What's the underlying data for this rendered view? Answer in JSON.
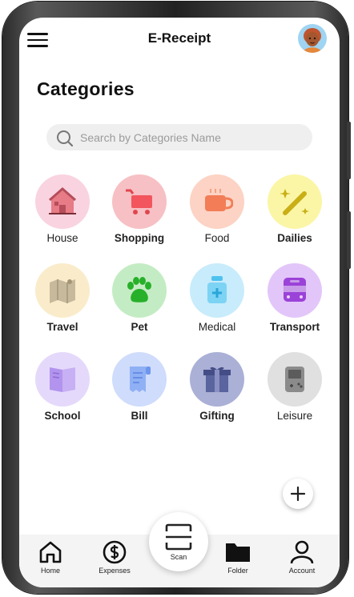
{
  "header": {
    "title": "E-Receipt",
    "menu_icon": "hamburger-menu-icon",
    "avatar_icon": "user-avatar"
  },
  "page_title": "Categories",
  "search": {
    "placeholder": "Search by Categories Name",
    "value": "",
    "icon": "search-icon"
  },
  "categories": [
    {
      "label": "House",
      "icon": "house-icon",
      "circle_color": "#f9d3e0",
      "bold": false
    },
    {
      "label": "Shopping",
      "icon": "shopping-cart-icon",
      "circle_color": "#f7c0c4",
      "bold": true
    },
    {
      "label": "Food",
      "icon": "hot-drink-icon",
      "circle_color": "#fcd3c4",
      "bold": false
    },
    {
      "label": "Dailies",
      "icon": "magic-wand-icon",
      "circle_color": "#fbf6a6",
      "bold": true
    },
    {
      "label": "Travel",
      "icon": "map-icon",
      "circle_color": "#faeccb",
      "bold": true
    },
    {
      "label": "Pet",
      "icon": "paw-icon",
      "circle_color": "#c4ecc4",
      "bold": true
    },
    {
      "label": "Medical",
      "icon": "medicine-bottle-icon",
      "circle_color": "#c8ecfb",
      "bold": false
    },
    {
      "label": "Transport",
      "icon": "train-icon",
      "circle_color": "#e3c6f9",
      "bold": true
    },
    {
      "label": "School",
      "icon": "open-book-icon",
      "circle_color": "#e5d9fb",
      "bold": true
    },
    {
      "label": "Bill",
      "icon": "bill-icon",
      "circle_color": "#cfdcfb",
      "bold": true
    },
    {
      "label": "Gifting",
      "icon": "gift-box-icon",
      "circle_color": "#aab0d6",
      "bold": true
    },
    {
      "label": "Leisure",
      "icon": "game-console-icon",
      "circle_color": "#e0e0e0",
      "bold": false
    }
  ],
  "add_button_icon": "plus-icon",
  "bottom_nav": {
    "items": [
      {
        "label": "Home",
        "icon": "home-icon"
      },
      {
        "label": "Expenses",
        "icon": "dollar-circle-icon"
      },
      {
        "label": "Scan",
        "icon": "scan-icon"
      },
      {
        "label": "Folder",
        "icon": "folder-icon"
      },
      {
        "label": "Account",
        "icon": "account-icon"
      }
    ]
  }
}
